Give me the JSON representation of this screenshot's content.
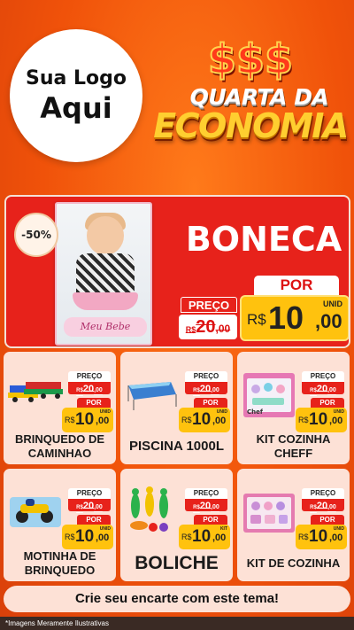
{
  "logo": {
    "line1": "Sua Logo",
    "line2": "Aqui"
  },
  "promo": {
    "dollars": "$$$",
    "line1": "QUARTA DA",
    "line2": "ECONOMIA"
  },
  "hero": {
    "discount": "-50%",
    "image_label": "Meu Bebe",
    "name": "BONECA",
    "preco_label": "PREÇO",
    "old_currency": "R$",
    "old_int": "20",
    "old_dec": ",00",
    "por_label": "POR",
    "currency": "R$",
    "price_int": "10",
    "price_dec": ",00",
    "unit": "UNID"
  },
  "products": [
    {
      "name": "BRINQUEDO DE CAMINHAO",
      "preco_label": "PREÇO",
      "old_currency": "R$",
      "old_int": "20",
      "old_dec": ",00",
      "por_label": "POR",
      "currency": "R$",
      "price_int": "10",
      "price_dec": ",00",
      "unit": "UNID"
    },
    {
      "name": "PISCINA 1000L",
      "preco_label": "PREÇO",
      "old_currency": "R$",
      "old_int": "20",
      "old_dec": ",00",
      "por_label": "POR",
      "currency": "R$",
      "price_int": "10",
      "price_dec": ",00",
      "unit": "UNID"
    },
    {
      "name": "KIT COZINHA CHEFF",
      "preco_label": "PREÇO",
      "old_currency": "R$",
      "old_int": "20",
      "old_dec": ",00",
      "por_label": "POR",
      "currency": "R$",
      "price_int": "10",
      "price_dec": ",00",
      "unit": "UNID",
      "image_label": "Chef"
    },
    {
      "name": "MOTINHA DE BRINQUEDO",
      "preco_label": "PREÇO",
      "old_currency": "R$",
      "old_int": "20",
      "old_dec": ",00",
      "por_label": "POR",
      "currency": "R$",
      "price_int": "10",
      "price_dec": ",00",
      "unit": "UNID"
    },
    {
      "name": "BOLICHE",
      "preco_label": "PREÇO",
      "old_currency": "R$",
      "old_int": "20",
      "old_dec": ",00",
      "por_label": "POR",
      "currency": "R$",
      "price_int": "10",
      "price_dec": ",00",
      "unit": "KIT"
    },
    {
      "name": "KIT DE COZINHA",
      "preco_label": "PREÇO",
      "old_currency": "R$",
      "old_int": "20",
      "old_dec": ",00",
      "por_label": "POR",
      "currency": "R$",
      "price_int": "10",
      "price_dec": ",00",
      "unit": "UNID"
    }
  ],
  "cta": "Crie seu encarte com este tema!",
  "footer": "*Imagens Meramente Ilustrativas",
  "colors": {
    "background": "#f0520a",
    "red": "#e7221b",
    "yellow": "#ffc20e",
    "card": "#fde1d6"
  }
}
